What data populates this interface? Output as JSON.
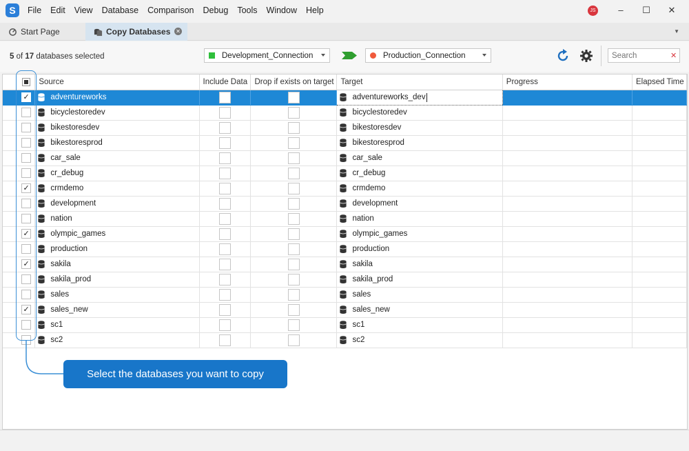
{
  "menu": [
    "File",
    "Edit",
    "View",
    "Database",
    "Comparison",
    "Debug",
    "Tools",
    "Window",
    "Help"
  ],
  "user_initials": "JS",
  "tabs": {
    "start": "Start Page",
    "active": "Copy Databases"
  },
  "selection": {
    "count": "5",
    "of": "of",
    "total": "17",
    "suffix": "databases selected"
  },
  "source_connection": "Development_Connection",
  "target_connection": "Production_Connection",
  "search_placeholder": "Search",
  "columns": {
    "source": "Source",
    "include": "Include Data",
    "drop": "Drop if exists on target",
    "target": "Target",
    "progress": "Progress",
    "elapsed": "Elapsed Time"
  },
  "rows": [
    {
      "source": "adventureworks",
      "target": "adventureworks_dev",
      "checked": true
    },
    {
      "source": "bicyclestoredev",
      "target": "bicyclestoredev",
      "checked": false
    },
    {
      "source": "bikestoresdev",
      "target": "bikestoresdev",
      "checked": false
    },
    {
      "source": "bikestoresprod",
      "target": "bikestoresprod",
      "checked": false
    },
    {
      "source": "car_sale",
      "target": "car_sale",
      "checked": false
    },
    {
      "source": "cr_debug",
      "target": "cr_debug",
      "checked": false
    },
    {
      "source": "crmdemo",
      "target": "crmdemo",
      "checked": true
    },
    {
      "source": "development",
      "target": "development",
      "checked": false
    },
    {
      "source": "nation",
      "target": "nation",
      "checked": false
    },
    {
      "source": "olympic_games",
      "target": "olympic_games",
      "checked": true
    },
    {
      "source": "production",
      "target": "production",
      "checked": false
    },
    {
      "source": "sakila",
      "target": "sakila",
      "checked": true
    },
    {
      "source": "sakila_prod",
      "target": "sakila_prod",
      "checked": false
    },
    {
      "source": "sales",
      "target": "sales",
      "checked": false
    },
    {
      "source": "sales_new",
      "target": "sales_new",
      "checked": true
    },
    {
      "source": "sc1",
      "target": "sc1",
      "checked": false
    },
    {
      "source": "sc2",
      "target": "sc2",
      "checked": false
    }
  ],
  "callout": "Select the databases you want to copy",
  "colors": {
    "selected_row": "#1e88d6",
    "dev_dot": "#2fbf3b",
    "prod_dot": "#f05a3c",
    "callout": "#1876c9"
  }
}
